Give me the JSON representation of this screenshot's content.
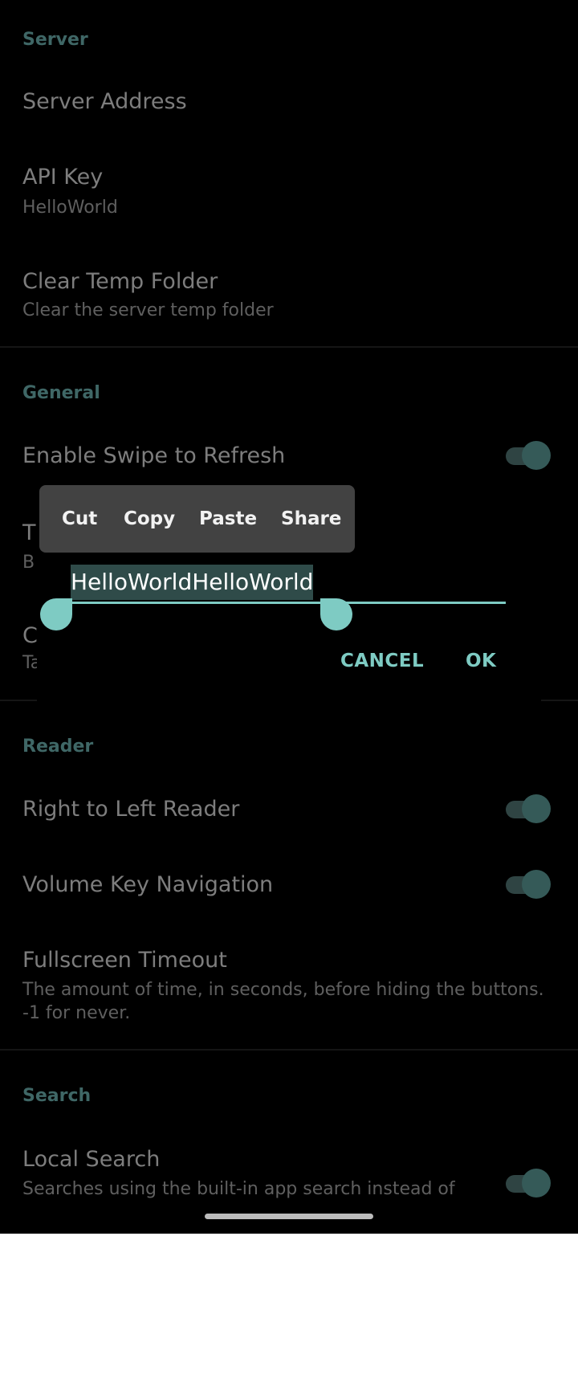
{
  "sections": {
    "server": {
      "title": "Server",
      "server_address": {
        "title": "Server Address"
      },
      "api_key": {
        "title": "API Key",
        "summary": "HelloWorld"
      },
      "clear_temp": {
        "title": "Clear Temp Folder",
        "summary": "Clear the server temp folder"
      }
    },
    "general": {
      "title": "General",
      "swipe_refresh": {
        "title": "Enable Swipe to Refresh",
        "enabled": true
      },
      "hidden_item_1": {
        "title_fragment": "T",
        "summary_fragment": "B"
      },
      "hidden_item_2": {
        "title_fragment": "C",
        "summary_fragment": "Ta"
      }
    },
    "reader": {
      "title": "Reader",
      "rtl": {
        "title": "Right to Left Reader",
        "enabled": true
      },
      "volume_keys": {
        "title": "Volume Key Navigation",
        "enabled": true
      },
      "fullscreen_timeout": {
        "title": "Fullscreen Timeout",
        "summary_line1": "The amount of time, in seconds, before hiding the buttons.",
        "summary_line2": "-1 for never."
      }
    },
    "search": {
      "title": "Search",
      "local_search": {
        "title": "Local Search",
        "summary": "Searches using the built-in app search instead of",
        "enabled": true
      }
    }
  },
  "dialog": {
    "input_value": "HelloWorldHelloWorld",
    "cancel_label": "CANCEL",
    "ok_label": "OK"
  },
  "context_menu": {
    "items": [
      "Cut",
      "Copy",
      "Paste",
      "Share"
    ]
  },
  "colors": {
    "accent": "#7ecbc3",
    "section_title": "#3f6766",
    "background": "#000000"
  }
}
